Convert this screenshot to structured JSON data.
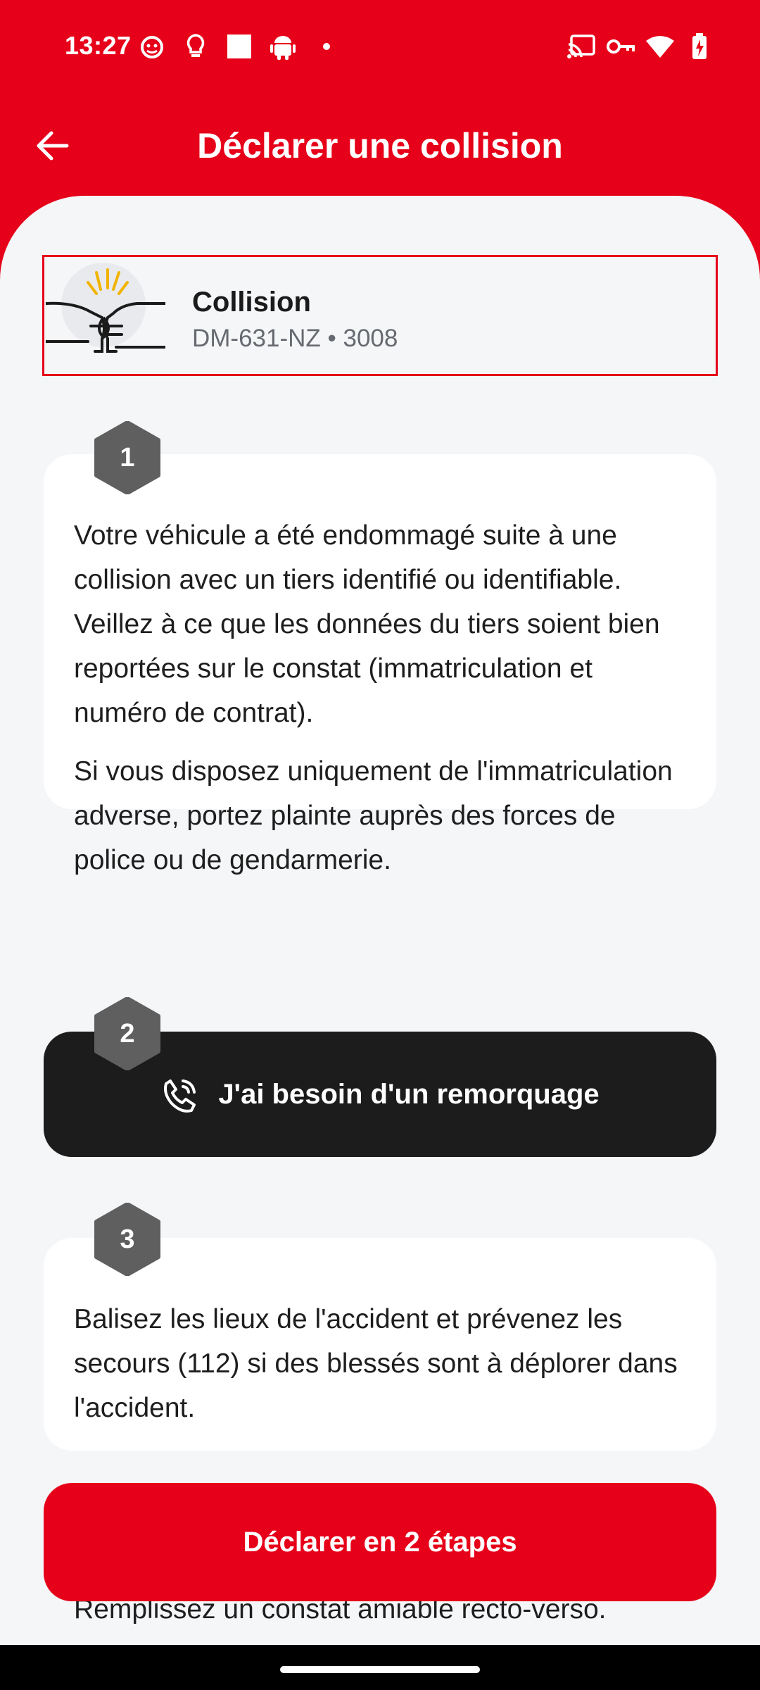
{
  "status_bar": {
    "time": "13:27",
    "left_icons": [
      "face-icon",
      "lightbulb-icon",
      "square-icon",
      "android-icon",
      "dot-icon"
    ],
    "right_icons": [
      "cast-icon",
      "key-icon",
      "wifi-icon",
      "battery-charging-icon"
    ]
  },
  "app_bar": {
    "title": "Déclarer une collision",
    "back_icon": "arrow-left-icon"
  },
  "vehicle": {
    "title": "Collision",
    "subtitle": "DM-631-NZ • 3008",
    "illustration": "collision-icon"
  },
  "steps": [
    {
      "number": "1",
      "paragraphs": [
        "Votre véhicule a été endommagé suite à une collision avec un tiers identifié ou identifiable. Veillez à ce que les données du tiers soient bien reportées sur le constat (immatriculation et numéro de contrat).",
        "Si vous disposez uniquement de l'immatriculation adverse, portez plainte auprès des forces de police ou de gendarmerie."
      ]
    },
    {
      "number": "2",
      "button_label": "J'ai besoin d'un remorquage",
      "button_icon": "phone-call-icon"
    },
    {
      "number": "3",
      "text": "Balisez les lieux de l'accident et prévenez les secours (112) si des blessés sont à déplorer dans l'accident."
    }
  ],
  "partial_text": "Remplissez un constat amiable recto-verso.",
  "declare_button": {
    "label": "Déclarer en 2 étapes"
  },
  "colors": {
    "brand_red": "#e60019",
    "sheet_bg": "#f5f6f8",
    "hex_badge": "#5f5f5f",
    "dark_button": "#1c1c1c"
  }
}
